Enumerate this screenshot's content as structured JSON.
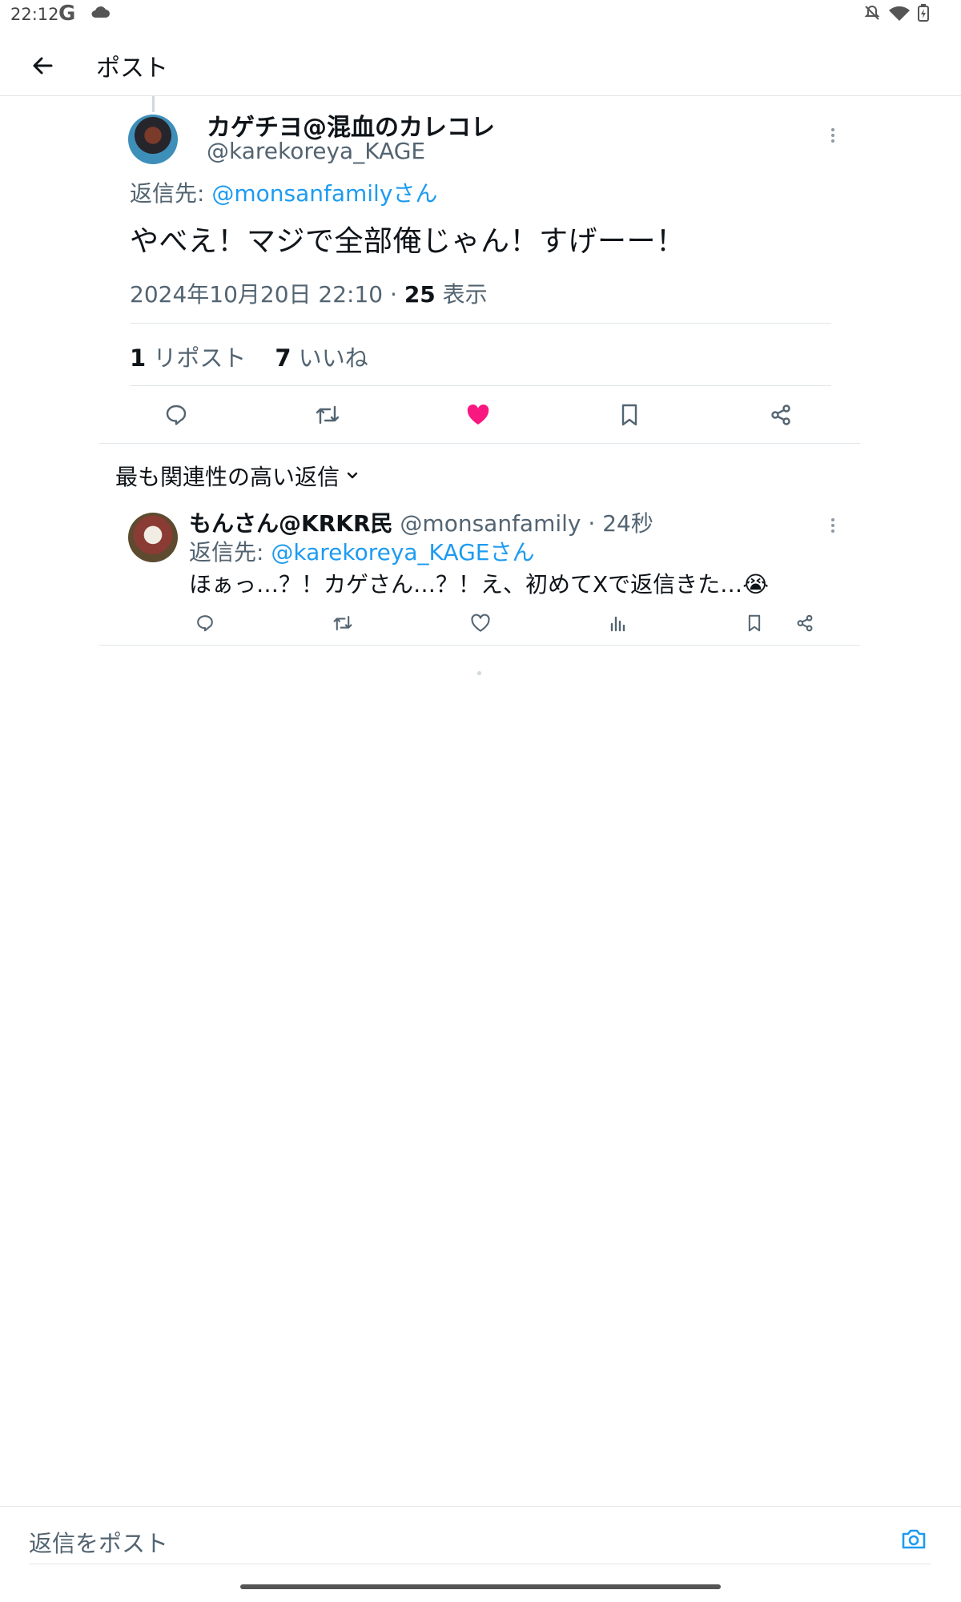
{
  "status_bar": {
    "time": "22:12",
    "google_glyph": "G",
    "icons": [
      "cloud-icon",
      "mute-icon",
      "wifi-icon",
      "battery-icon"
    ]
  },
  "header": {
    "title": "ポスト",
    "back_icon": "arrow-left-icon"
  },
  "main_post": {
    "author_name": "カゲチヨ@混血のカレコレ",
    "author_handle": "@karekoreya_KAGE",
    "reply_to_label": "返信先: ",
    "reply_to_user": "@monsanfamilyさん",
    "text": "やべえ！マジで全部俺じゃん！すげーー！",
    "timestamp": "2024年10月20日 22:10 · ",
    "view_count": "25",
    "view_label": " 表示",
    "repost_count": "1",
    "repost_label": " リポスト",
    "like_count": "7",
    "like_label": " いいね",
    "liked": true
  },
  "replies_section": {
    "sort_label": "最も関連性の高い返信"
  },
  "reply_post": {
    "author_name": "もんさん@KRKR民",
    "author_handle": " @monsanfamily",
    "time_ago": " · 24秒",
    "reply_to_label": "返信先: ",
    "reply_to_user": "@karekoreya_KAGEさん",
    "text": "ほぁっ…？！カゲさん…？！え、初めてXで返信きた…",
    "emoji": "😭"
  },
  "compose": {
    "placeholder": "返信をポスト"
  },
  "colors": {
    "accent": "#1d9bf0",
    "like": "#f91880",
    "text_primary": "#0f1419",
    "text_secondary": "#536471"
  }
}
